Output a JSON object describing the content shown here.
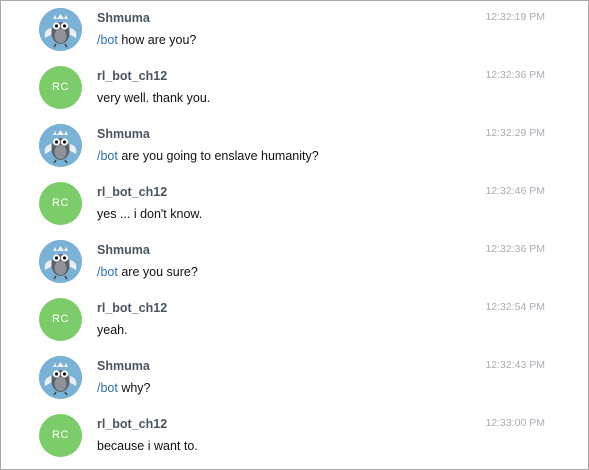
{
  "messages": [
    {
      "sender": "Shmuma",
      "avatar": "owl-avatar",
      "time": "12:32:19 PM",
      "command": "/bot",
      "text": " how are you?"
    },
    {
      "sender": "rl_bot_ch12",
      "avatar_initials": "RC",
      "time": "12:32:36 PM",
      "text": "very well. thank you."
    },
    {
      "sender": "Shmuma",
      "avatar": "owl-avatar",
      "time": "12:32:29 PM",
      "command": "/bot",
      "text": " are you going to enslave humanity?"
    },
    {
      "sender": "rl_bot_ch12",
      "avatar_initials": "RC",
      "time": "12:32:46 PM",
      "text": "yes ... i don't know."
    },
    {
      "sender": "Shmuma",
      "avatar": "owl-avatar",
      "time": "12:32:36 PM",
      "command": "/bot",
      "text": " are you sure?"
    },
    {
      "sender": "rl_bot_ch12",
      "avatar_initials": "RC",
      "time": "12:32:54 PM",
      "text": "yeah."
    },
    {
      "sender": "Shmuma",
      "avatar": "owl-avatar",
      "time": "12:32:43 PM",
      "command": "/bot",
      "text": " why?"
    },
    {
      "sender": "rl_bot_ch12",
      "avatar_initials": "RC",
      "time": "12:33:00 PM",
      "text": "because i want to."
    }
  ],
  "colors": {
    "bot_avatar": "#7dcc6a",
    "user_avatar": "#7ab2d6",
    "sender_name": "#4a5560",
    "timestamp": "#a8aeb4",
    "command": "#2a6fb0"
  }
}
